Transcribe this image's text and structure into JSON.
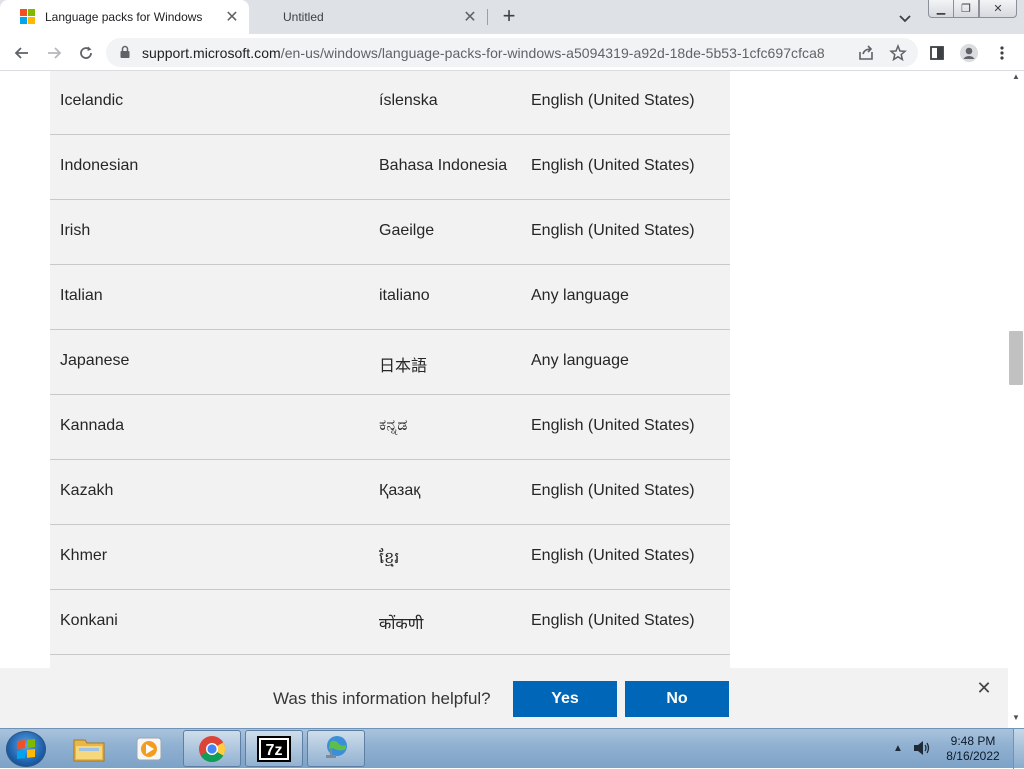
{
  "browser": {
    "tabs": [
      {
        "title": "Language packs for Windows",
        "active": true
      },
      {
        "title": "Untitled",
        "active": false
      }
    ],
    "url_host": "support.microsoft.com",
    "url_path": "/en-us/windows/language-packs-for-windows-a5094319-a92d-18de-5b53-1cfc697cfca8"
  },
  "languages": [
    {
      "language": "Icelandic",
      "native": "íslenska",
      "base": "English (United States)"
    },
    {
      "language": "Indonesian",
      "native": "Bahasa Indonesia",
      "base": "English (United States)"
    },
    {
      "language": "Irish",
      "native": "Gaeilge",
      "base": "English (United States)"
    },
    {
      "language": "Italian",
      "native": "italiano",
      "base": "Any language"
    },
    {
      "language": "Japanese",
      "native": "日本語",
      "base": "Any language"
    },
    {
      "language": "Kannada",
      "native": "ಕನ್ನಡ",
      "base": "English (United States)"
    },
    {
      "language": "Kazakh",
      "native": "Қазақ",
      "base": "English (United States)"
    },
    {
      "language": "Khmer",
      "native": "ខ្មែរ",
      "base": "English (United States)"
    },
    {
      "language": "Konkani",
      "native": "कोंकणी",
      "base": "English (United States)"
    }
  ],
  "feedback": {
    "question": "Was this information helpful?",
    "yes": "Yes",
    "no": "No"
  },
  "taskbar": {
    "time": "9:48 PM",
    "date": "8/16/2022",
    "apps": [
      "windows-explorer-icon",
      "media-player-icon",
      "chrome-icon",
      "7zip-icon",
      "network-globe-icon"
    ]
  },
  "colors": {
    "accent": "#0067b8",
    "row_background": "#f2f2f2"
  }
}
